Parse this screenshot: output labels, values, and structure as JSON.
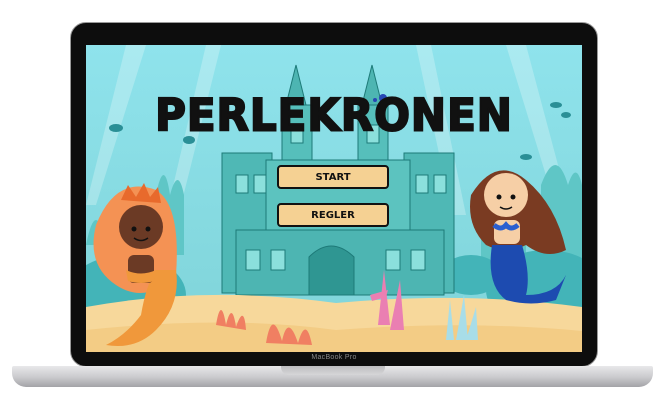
{
  "device": {
    "brand_label": "MacBook Pro"
  },
  "game": {
    "title": "PERLEKRONEN",
    "menu": {
      "start_label": "START",
      "rules_label": "REGLER"
    }
  },
  "colors": {
    "sea": "#8fdfe8",
    "sand": "#f5d193",
    "castle": "#3aa9a6",
    "button": "#f5d193",
    "text": "#111111"
  }
}
